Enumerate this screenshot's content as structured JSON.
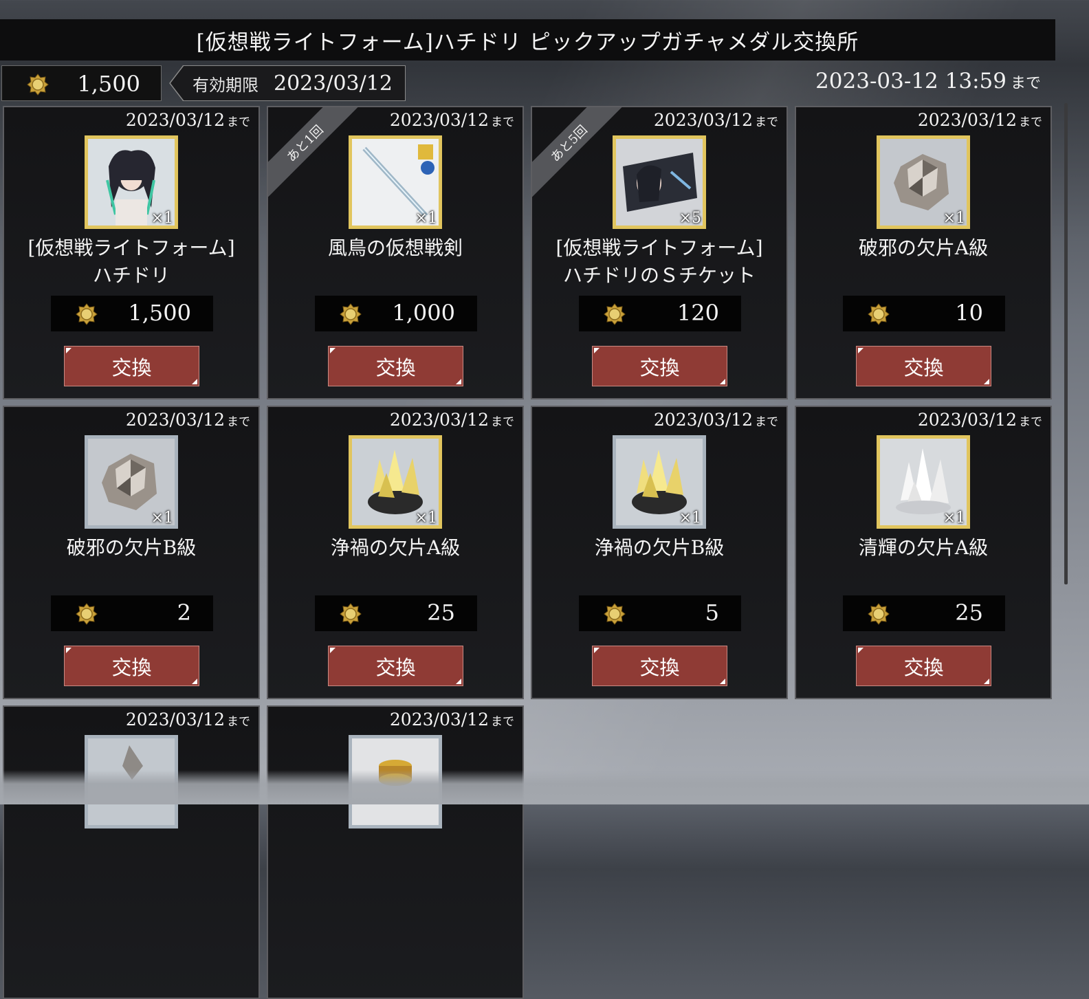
{
  "header": {
    "title": "[仮想戦ライトフォーム]ハチドリ ピックアップガチャメダル交換所",
    "currency_amount": "1,500",
    "currency_icon": "medal-icon",
    "expiry_label": "有効期限",
    "expiry_date": "2023/03/12",
    "deadline_time": "2023-03-12 13:59",
    "deadline_suffix": "まで"
  },
  "cards": [
    {
      "date": "2023/03/12",
      "date_suffix": "まで",
      "ribbon": "",
      "name_line1": "[仮想戦ライトフォーム]",
      "name_line2": "ハチドリ",
      "qty": "×1",
      "cost": "1,500",
      "button": "交換",
      "icon": "character-portrait-icon",
      "frame": "gold"
    },
    {
      "date": "2023/03/12",
      "date_suffix": "まで",
      "ribbon": "あと1回",
      "name_line1": "風鳥の仮想戦剣",
      "name_line2": "",
      "qty": "×1",
      "cost": "1,000",
      "button": "交換",
      "icon": "sword-icon",
      "frame": "gold"
    },
    {
      "date": "2023/03/12",
      "date_suffix": "まで",
      "ribbon": "あと5回",
      "name_line1": "[仮想戦ライトフォーム]",
      "name_line2": "ハチドリのＳチケット",
      "qty": "×5",
      "cost": "120",
      "button": "交換",
      "icon": "ticket-icon",
      "frame": "gold"
    },
    {
      "date": "2023/03/12",
      "date_suffix": "まで",
      "ribbon": "",
      "name_line1": "破邪の欠片A級",
      "name_line2": "",
      "qty": "×1",
      "cost": "10",
      "button": "交換",
      "icon": "metal-ore-icon",
      "frame": "gold"
    },
    {
      "date": "2023/03/12",
      "date_suffix": "まで",
      "ribbon": "",
      "name_line1": "破邪の欠片B級",
      "name_line2": "",
      "qty": "×1",
      "cost": "2",
      "button": "交換",
      "icon": "metal-ore-icon",
      "frame": "silver"
    },
    {
      "date": "2023/03/12",
      "date_suffix": "まで",
      "ribbon": "",
      "name_line1": "浄禍の欠片A級",
      "name_line2": "",
      "qty": "×1",
      "cost": "25",
      "button": "交換",
      "icon": "gold-crystal-icon",
      "frame": "gold"
    },
    {
      "date": "2023/03/12",
      "date_suffix": "まで",
      "ribbon": "",
      "name_line1": "浄禍の欠片B級",
      "name_line2": "",
      "qty": "×1",
      "cost": "5",
      "button": "交換",
      "icon": "gold-crystal-icon",
      "frame": "silver"
    },
    {
      "date": "2023/03/12",
      "date_suffix": "まで",
      "ribbon": "",
      "name_line1": "清輝の欠片A級",
      "name_line2": "",
      "qty": "×1",
      "cost": "25",
      "button": "交換",
      "icon": "white-crystal-icon",
      "frame": "gold"
    },
    {
      "date": "2023/03/12",
      "date_suffix": "まで",
      "ribbon": "",
      "name_line1": "",
      "name_line2": "",
      "qty": "",
      "cost": "",
      "button": "",
      "icon": "shard-icon",
      "frame": "silver"
    },
    {
      "date": "2023/03/12",
      "date_suffix": "まで",
      "ribbon": "",
      "name_line1": "",
      "name_line2": "",
      "qty": "",
      "cost": "",
      "button": "",
      "icon": "coin-stack-icon",
      "frame": "silver"
    }
  ],
  "colors": {
    "button": "#8f3b35",
    "gold_frame": "#e1c55e",
    "silver_frame": "#a9b3bd",
    "title_bar": "#0d0d0e"
  }
}
